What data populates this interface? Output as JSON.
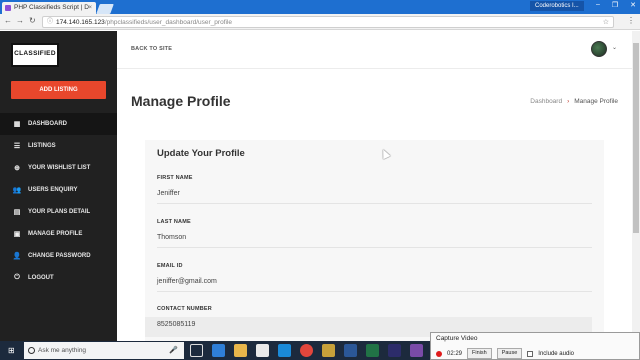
{
  "browser": {
    "tab_title": "PHP Classifieds Script | D",
    "tab_close": "×",
    "window_user": "Coderobotics I...",
    "url_host": "174.140.165.123",
    "url_path": "/phpclassifieds/user_dashboard/user_profile"
  },
  "sidebar": {
    "logo": "CLASSIFIED",
    "add_listing": "ADD LISTING",
    "items": [
      {
        "label": "DASHBOARD",
        "icon": "dashboard-icon"
      },
      {
        "label": "LISTINGS",
        "icon": "list-icon"
      },
      {
        "label": "YOUR WISHLIST LIST",
        "icon": "plus-circle-icon"
      },
      {
        "label": "USERS ENQUIRY",
        "icon": "users-icon"
      },
      {
        "label": "YOUR PLANS DETAIL",
        "icon": "plans-icon"
      },
      {
        "label": "MANAGE PROFILE",
        "icon": "profile-card-icon"
      },
      {
        "label": "CHANGE PASSWORD",
        "icon": "user-key-icon"
      },
      {
        "label": "LOGOUT",
        "icon": "power-icon"
      }
    ]
  },
  "topbar": {
    "back_link": "BACK TO SITE"
  },
  "main": {
    "title": "Manage Profile",
    "breadcrumb": {
      "parent": "Dashboard",
      "separator": "›",
      "current": "Manage Profile"
    },
    "card_title": "Update Your Profile",
    "fields": [
      {
        "label": "FIRST NAME",
        "value": "Jeniffer"
      },
      {
        "label": "LAST NAME",
        "value": "Thomson"
      },
      {
        "label": "EMAIL ID",
        "value": "jeniffer@gmail.com"
      },
      {
        "label": "CONTACT NUMBER",
        "value": "8525085119"
      }
    ]
  },
  "taskbar": {
    "search_placeholder": "Ask me anything"
  },
  "capture": {
    "title": "Capture Video",
    "time": "02:29",
    "finish": "Finish",
    "pause": "Pause",
    "include_audio": "Include audio"
  },
  "colors": {
    "accent": "#e8472c",
    "sidebar_bg": "#212121",
    "browser_blue": "#1e6fd0"
  }
}
